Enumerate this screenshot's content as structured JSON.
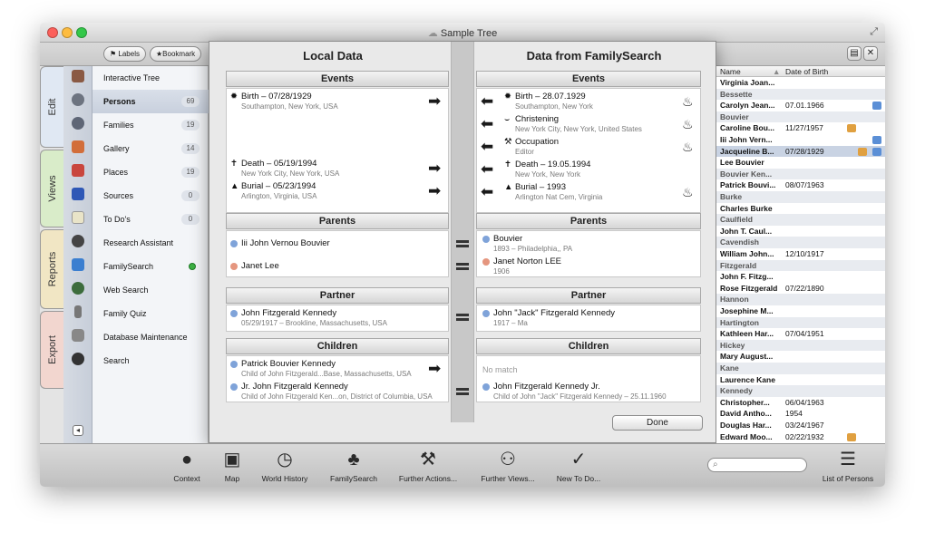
{
  "window": {
    "title": "Sample Tree"
  },
  "top_toolbar": {
    "labels_button": "Labels",
    "bookmark_button": "Bookmark"
  },
  "side_tabs": [
    "Edit",
    "Views",
    "Reports",
    "Export"
  ],
  "sidebar": {
    "items": [
      {
        "label": "Interactive Tree",
        "count": ""
      },
      {
        "label": "Persons",
        "count": "69"
      },
      {
        "label": "Families",
        "count": "19"
      },
      {
        "label": "Gallery",
        "count": "14"
      },
      {
        "label": "Places",
        "count": "19"
      },
      {
        "label": "Sources",
        "count": "0"
      },
      {
        "label": "To Do's",
        "count": "0"
      },
      {
        "label": "Research Assistant",
        "count": ""
      },
      {
        "label": "FamilySearch",
        "count": ""
      },
      {
        "label": "Web Search",
        "count": ""
      },
      {
        "label": "Family Quiz",
        "count": ""
      },
      {
        "label": "Database Maintenance",
        "count": ""
      },
      {
        "label": "Search",
        "count": ""
      }
    ]
  },
  "dialog": {
    "local_title": "Local Data",
    "remote_title": "Data from FamilySearch",
    "sections": {
      "events": "Events",
      "parents": "Parents",
      "partner": "Partner",
      "children": "Children"
    },
    "local_events": [
      {
        "title": "Birth – 07/28/1929",
        "detail": "Southampton, New York, USA"
      },
      {
        "title": "Death – 05/19/1994",
        "detail": "New York City, New York, USA"
      },
      {
        "title": "Burial – 05/23/1994",
        "detail": "Arlington, Virginia, USA"
      }
    ],
    "remote_events": [
      {
        "title": "Birth – 28.07.1929",
        "detail": "Southampton, New York"
      },
      {
        "title": "Christening",
        "detail": "New York City, New York, United States"
      },
      {
        "title": "Occupation",
        "detail": "Editor"
      },
      {
        "title": "Death – 19.05.1994",
        "detail": "New York, New York"
      },
      {
        "title": "Burial – 1993",
        "detail": "Arlington Nat Cem, Virginia"
      }
    ],
    "local_parents": [
      {
        "title": "Iii John Vernou Bouvier",
        "detail": ""
      },
      {
        "title": "Janet Lee",
        "detail": ""
      }
    ],
    "remote_parents": [
      {
        "title": "Bouvier",
        "detail": "1893 – Philadelphia,, PA"
      },
      {
        "title": "Janet Norton LEE",
        "detail": "1906"
      }
    ],
    "local_partner": {
      "title": "John Fitzgerald Kennedy",
      "detail": "05/29/1917 – Brookline, Massachusetts, USA"
    },
    "remote_partner": {
      "title": "John \"Jack\" Fitzgerald Kennedy",
      "detail": "1917 – Ma"
    },
    "local_children": [
      {
        "title": "Patrick Bouvier Kennedy",
        "detail": "Child of John Fitzgerald...Base, Massachusetts, USA"
      },
      {
        "title": "Jr. John Fitzgerald Kennedy",
        "detail": "Child of John Fitzgerald Ken...on, District of Columbia, USA"
      }
    ],
    "remote_children": [
      {
        "title": "No match",
        "detail": ""
      },
      {
        "title": "John Fitzgerald Kennedy Jr.",
        "detail": "Child of John \"Jack\" Fitzgerald Kennedy – 25.11.1960"
      }
    ],
    "done_label": "Done"
  },
  "persons_list": {
    "header_name": "Name",
    "header_date": "Date of Birth",
    "rows": [
      {
        "type": "person",
        "name": "Virginia Joan...",
        "date": ""
      },
      {
        "type": "group",
        "name": "Bessette"
      },
      {
        "type": "person",
        "name": "Carolyn Jean...",
        "date": "07.01.1966"
      },
      {
        "type": "group",
        "name": "Bouvier"
      },
      {
        "type": "person",
        "name": "Caroline Bou...",
        "date": "11/27/1957"
      },
      {
        "type": "person",
        "name": "Iii John Vern...",
        "date": ""
      },
      {
        "type": "person",
        "name": "Jacqueline B...",
        "date": "07/28/1929"
      },
      {
        "type": "person",
        "name": "Lee Bouvier",
        "date": ""
      },
      {
        "type": "group",
        "name": "Bouvier Ken..."
      },
      {
        "type": "person",
        "name": "Patrick Bouvi...",
        "date": "08/07/1963"
      },
      {
        "type": "group",
        "name": "Burke"
      },
      {
        "type": "person",
        "name": "Charles Burke",
        "date": ""
      },
      {
        "type": "group",
        "name": "Caulfield"
      },
      {
        "type": "person",
        "name": "John T. Caul...",
        "date": ""
      },
      {
        "type": "group",
        "name": "Cavendish"
      },
      {
        "type": "person",
        "name": "William John...",
        "date": "12/10/1917"
      },
      {
        "type": "group",
        "name": "Fitzgerald"
      },
      {
        "type": "person",
        "name": "John F. Fitzg...",
        "date": ""
      },
      {
        "type": "person",
        "name": "Rose Fitzgerald",
        "date": "07/22/1890"
      },
      {
        "type": "group",
        "name": "Hannon"
      },
      {
        "type": "person",
        "name": "Josephine M...",
        "date": ""
      },
      {
        "type": "group",
        "name": "Hartington"
      },
      {
        "type": "person",
        "name": "Kathleen Har...",
        "date": "07/04/1951"
      },
      {
        "type": "group",
        "name": "Hickey"
      },
      {
        "type": "person",
        "name": "Mary August...",
        "date": ""
      },
      {
        "type": "group",
        "name": "Kane"
      },
      {
        "type": "person",
        "name": "Laurence Kane",
        "date": ""
      },
      {
        "type": "group",
        "name": "Kennedy"
      },
      {
        "type": "person",
        "name": "Christopher...",
        "date": "06/04/1963"
      },
      {
        "type": "person",
        "name": "David Antho...",
        "date": "1954"
      },
      {
        "type": "person",
        "name": "Douglas Har...",
        "date": "03/24/1967"
      },
      {
        "type": "person",
        "name": "Edward Moo...",
        "date": "02/22/1932"
      }
    ]
  },
  "bottom_toolbar": {
    "items": [
      "Context",
      "Map",
      "World History",
      "FamilySearch",
      "Further Actions...",
      "Further Views...",
      "New To Do..."
    ],
    "list_of_persons": "List of Persons"
  },
  "colors": {
    "accent_blue": "#5b8fd6",
    "traffic_red": "#fc605b",
    "traffic_yellow": "#fdbc40",
    "traffic_green": "#34c84a",
    "status_green": "#3cb043"
  }
}
